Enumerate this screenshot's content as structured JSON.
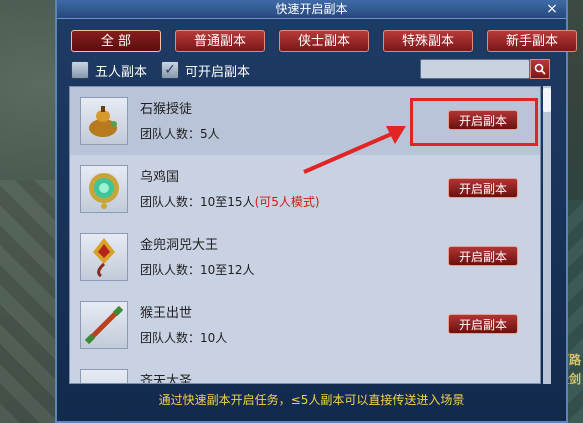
{
  "window": {
    "title": "快速开启副本",
    "close_glyph": "×"
  },
  "tabs": [
    {
      "label": "全 部",
      "active": true
    },
    {
      "label": "普通副本",
      "active": false
    },
    {
      "label": "侠士副本",
      "active": false
    },
    {
      "label": "特殊副本",
      "active": false
    },
    {
      "label": "新手副本",
      "active": false
    }
  ],
  "filters": {
    "five_person": {
      "label": "五人副本",
      "checked": false
    },
    "can_open": {
      "label": "可开启副本",
      "checked": true,
      "check_glyph": "✓"
    }
  },
  "search": {
    "placeholder": "",
    "icon": "search-icon"
  },
  "dungeons": [
    {
      "name": "石猴授徒",
      "members_label": "团队人数：",
      "members": "5人",
      "note": "",
      "button": "开启副本",
      "icon": "gourd-icon"
    },
    {
      "name": "乌鸡国",
      "members_label": "团队人数：",
      "members": "10至15人",
      "note": "(可5人模式)",
      "button": "开启副本",
      "icon": "jade-amulet-icon"
    },
    {
      "name": "金兜洞兕大王",
      "members_label": "团队人数：",
      "members": "10至12人",
      "note": "",
      "button": "开启副本",
      "icon": "golden-ornament-icon"
    },
    {
      "name": "猴王出世",
      "members_label": "团队人数：",
      "members": "10人",
      "note": "",
      "button": "开启副本",
      "icon": "staff-icon"
    },
    {
      "name": "齐天大圣",
      "members_label": "",
      "members": "",
      "note": "",
      "button": "",
      "icon": "item-icon"
    }
  ],
  "footer": {
    "text": "通过快速副本开启任务，≤5人副本可以直接传送进入场景"
  },
  "side_texts": [
    "下路",
    "天剑"
  ],
  "colors": {
    "accent_red": "#b23434",
    "highlight": "#e12424",
    "footer_text": "#f2d24b"
  }
}
